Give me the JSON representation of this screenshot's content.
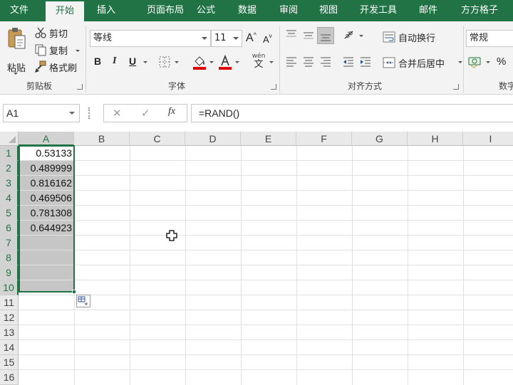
{
  "tabs": [
    "文件",
    "开始",
    "插入",
    "页面布局",
    "公式",
    "数据",
    "审阅",
    "视图",
    "开发工具",
    "邮件",
    "方方格子"
  ],
  "active_tab": "开始",
  "ribbon": {
    "clipboard": {
      "paste": "粘贴",
      "cut": "剪切",
      "copy": "复制",
      "format_painter": "格式刷",
      "group": "剪贴板"
    },
    "font": {
      "name": "等线",
      "size": "11",
      "grow": "A",
      "shrink": "A",
      "bold": "B",
      "italic": "I",
      "underline": "U",
      "phonetic_top": "wén",
      "phonetic_bottom": "文",
      "group": "字体"
    },
    "alignment": {
      "wrap": "自动换行",
      "merge": "合并后居中",
      "group": "对齐方式"
    },
    "number": {
      "format": "常规",
      "percent": "%",
      "group": "数字"
    }
  },
  "formula_bar": {
    "name_box": "A1",
    "cancel": "✕",
    "enter": "✓",
    "fx": "fx",
    "formula": "=RAND()"
  },
  "columns": [
    "A",
    "B",
    "C",
    "D",
    "E",
    "F",
    "G",
    "H",
    "I"
  ],
  "rows": [
    "1",
    "2",
    "3",
    "4",
    "5",
    "6",
    "7",
    "8",
    "9",
    "10",
    "11",
    "12",
    "13",
    "14",
    "15",
    "16"
  ],
  "cells_A": [
    "0.53133",
    "0.489999",
    "0.816162",
    "0.469506",
    "0.781308",
    "0.644923"
  ],
  "colors": {
    "accent": "#217346",
    "font_red": "#e00000",
    "fill_red": "#e00000",
    "selection": "#c6c6c6"
  }
}
